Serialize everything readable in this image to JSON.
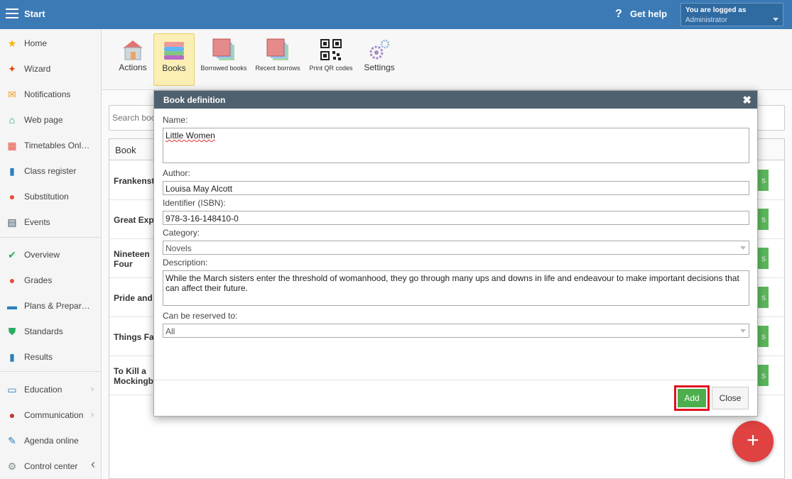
{
  "topbar": {
    "title": "Start",
    "help": "Get help",
    "user_line1": "You are logged as",
    "user_line2": "Administrator"
  },
  "sidebar": {
    "items": [
      {
        "label": "Home",
        "icon": "star-icon",
        "color": "#f4b400"
      },
      {
        "label": "Wizard",
        "icon": "wand-icon",
        "color": "#e64a19"
      },
      {
        "label": "Notifications",
        "icon": "envelope-icon",
        "color": "#f39c12"
      },
      {
        "label": "Web page",
        "icon": "house-icon",
        "color": "#16a085"
      },
      {
        "label": "Timetables Onl…",
        "icon": "grid-icon",
        "color": "#e74c3c"
      },
      {
        "label": "Class register",
        "icon": "book-icon",
        "color": "#2980b9"
      },
      {
        "label": "Substitution",
        "icon": "person-icon",
        "color": "#e74c3c"
      },
      {
        "label": "Events",
        "icon": "calendar-icon",
        "color": "#34495e"
      },
      {
        "label": "Overview",
        "icon": "check-circle-icon",
        "color": "#27ae60"
      },
      {
        "label": "Grades",
        "icon": "grades-icon",
        "color": "#e74c3c"
      },
      {
        "label": "Plans & Prepar…",
        "icon": "plans-icon",
        "color": "#2980b9"
      },
      {
        "label": "Standards",
        "icon": "shield-icon",
        "color": "#27ae60"
      },
      {
        "label": "Results",
        "icon": "bar-chart-icon",
        "color": "#2980b9"
      },
      {
        "label": "Education",
        "icon": "open-book-icon",
        "color": "#2980b9"
      },
      {
        "label": "Communication",
        "icon": "chat-icon",
        "color": "#c0392b"
      },
      {
        "label": "Agenda online",
        "icon": "pen-icon",
        "color": "#2980b9"
      },
      {
        "label": "Control center",
        "icon": "gear-icon",
        "color": "#7f8c8d"
      }
    ]
  },
  "toolbar": {
    "actions": "Actions",
    "books": "Books",
    "borrowed": "Borrowed books",
    "recent": "Recent borrows",
    "qr": "Print QR codes",
    "settings": "Settings"
  },
  "search": {
    "placeholder": "Search boo"
  },
  "table": {
    "header": "Book",
    "rows": [
      {
        "title": "Frankenst"
      },
      {
        "title": "Great Exp"
      },
      {
        "title": "Nineteen Four"
      },
      {
        "title": "Pride and"
      },
      {
        "title": "Things Fa"
      },
      {
        "title": "To Kill a Mockingb"
      }
    ],
    "row_button": "s"
  },
  "dialog": {
    "title": "Book definition",
    "name_label": "Name:",
    "name_value": "Little Women",
    "author_label": "Author:",
    "author_value": "Louisa May Alcott",
    "isbn_label": "Identifier (ISBN):",
    "isbn_value": "978-3-16-148410-0",
    "category_label": "Category:",
    "category_value": "Novels",
    "description_label": "Description:",
    "description_value": "While the March sisters enter the threshold of womanhood, they go through many ups and downs in life and endeavour to make important decisions that can affect their future.",
    "reserve_label": "Can be reserved to:",
    "reserve_value": "All",
    "add": "Add",
    "close": "Close"
  },
  "fab": "+"
}
